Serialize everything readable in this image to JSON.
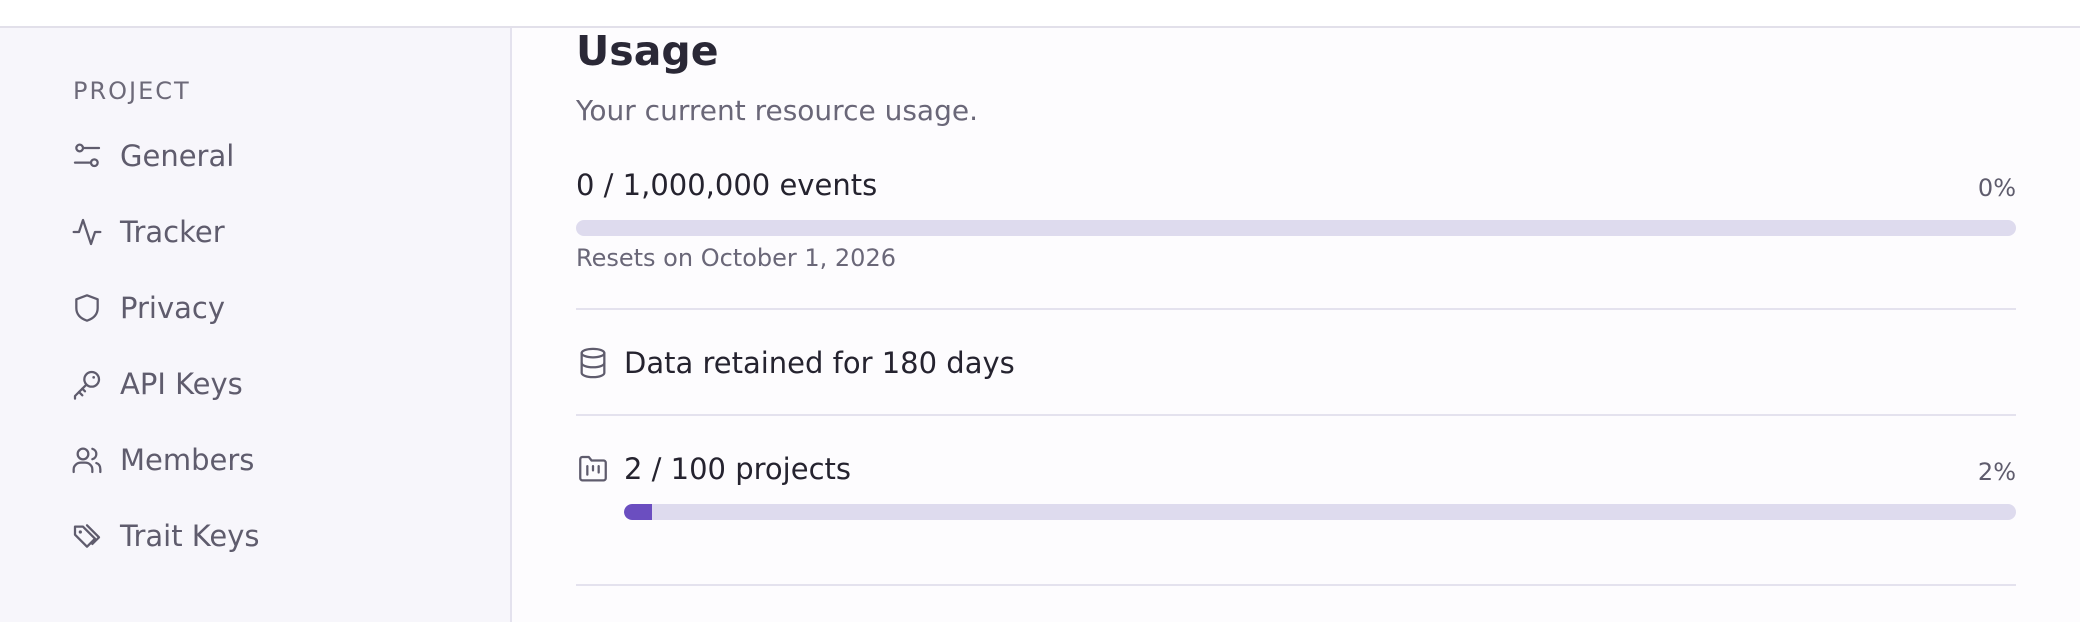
{
  "sidebar": {
    "heading": "PROJECT",
    "items": [
      {
        "label": "General",
        "icon": "sliders-icon"
      },
      {
        "label": "Tracker",
        "icon": "activity-icon"
      },
      {
        "label": "Privacy",
        "icon": "shield-icon"
      },
      {
        "label": "API Keys",
        "icon": "key-icon"
      },
      {
        "label": "Members",
        "icon": "users-icon"
      },
      {
        "label": "Trait Keys",
        "icon": "tags-icon"
      }
    ]
  },
  "usage": {
    "title": "Usage",
    "subtitle": "Your current resource usage.",
    "events": {
      "label": "0 / 1,000,000 events",
      "percent_label": "0%",
      "fill_fraction": 0,
      "reset_text": "Resets on October 1, 2026"
    },
    "retention": {
      "label": "Data retained for 180 days",
      "icon": "database-icon"
    },
    "projects": {
      "label": "2 / 100 projects",
      "percent_label": "2%",
      "fill_fraction": 0.02,
      "icon": "folder-kanban-icon"
    }
  },
  "colors": {
    "accent": "#6b4ec0",
    "track": "#dedbee",
    "sidebar_bg": "#f7f6fb"
  }
}
